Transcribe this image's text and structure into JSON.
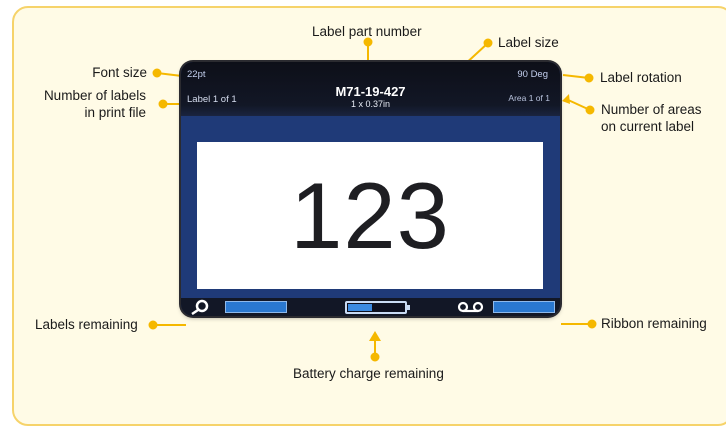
{
  "screen": {
    "font_size": "22pt",
    "label_count": "Label  1 of 1",
    "part_number": "M71-19-427",
    "label_size": "1 x 0.37in",
    "rotation": "90 Deg",
    "area_count": "Area 1 of 1",
    "label_text": "123",
    "labels_remaining": 1.0,
    "battery_remaining": 0.45,
    "ribbon_remaining": 1.0
  },
  "callouts": {
    "font_size": "Font size",
    "labels_in_file": [
      "Number of labels",
      "in print file"
    ],
    "part_number": "Label part number",
    "label_size": "Label size",
    "label_rotation": "Label rotation",
    "areas_on_label": [
      "Number of areas",
      "on current label"
    ],
    "labels_remaining": "Labels remaining",
    "ribbon_remaining": "Ribbon remaining",
    "battery_remaining": "Battery charge remaining"
  },
  "colors": {
    "callout_dot": "#f5b800",
    "frame_border": "#f6d36a",
    "frame_fill": "#fffbe6",
    "screen_blue": "#1f3a78"
  }
}
